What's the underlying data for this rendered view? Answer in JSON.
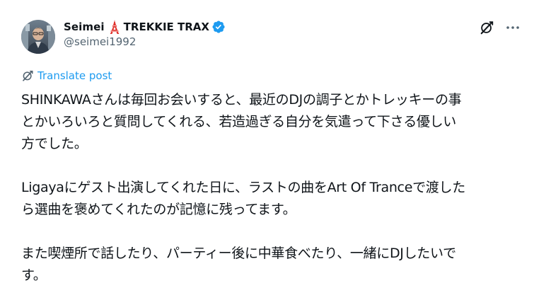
{
  "author": {
    "display_name": "Seimei",
    "org_name": "TREKKIE TRAX",
    "handle": "@seimei1992",
    "icons": {
      "name_emoji": "tokyo-tower-icon",
      "verified": "verified-badge-icon",
      "grok": "grok-icon",
      "more": "more-horizontal-icon",
      "translate": "translate-icon"
    }
  },
  "translate_label": "Translate post",
  "post": {
    "paragraph1_line1": "SHINKAWAさんは毎回お会いすると、最近のDJの調子とかトレッキーの事",
    "paragraph1_line2": "とかいろいろと質問してくれる、若造過ぎる自分を気遣って下さる優しい",
    "paragraph1_line3": "方でした。",
    "paragraph2_line1": "Ligayaにゲスト出演してくれた日に、ラストの曲をArt Of Tranceで渡した",
    "paragraph2_line2": "ら選曲を褒めてくれたのが記憶に残ってます。",
    "paragraph3_line1": "また喫煙所で話したり、パーティー後に中華食べたり、一緒にDJしたいで",
    "paragraph3_line2": "す。"
  },
  "colors": {
    "text": "#0f1419",
    "secondary": "#536471",
    "accent": "#1d9bf0"
  }
}
